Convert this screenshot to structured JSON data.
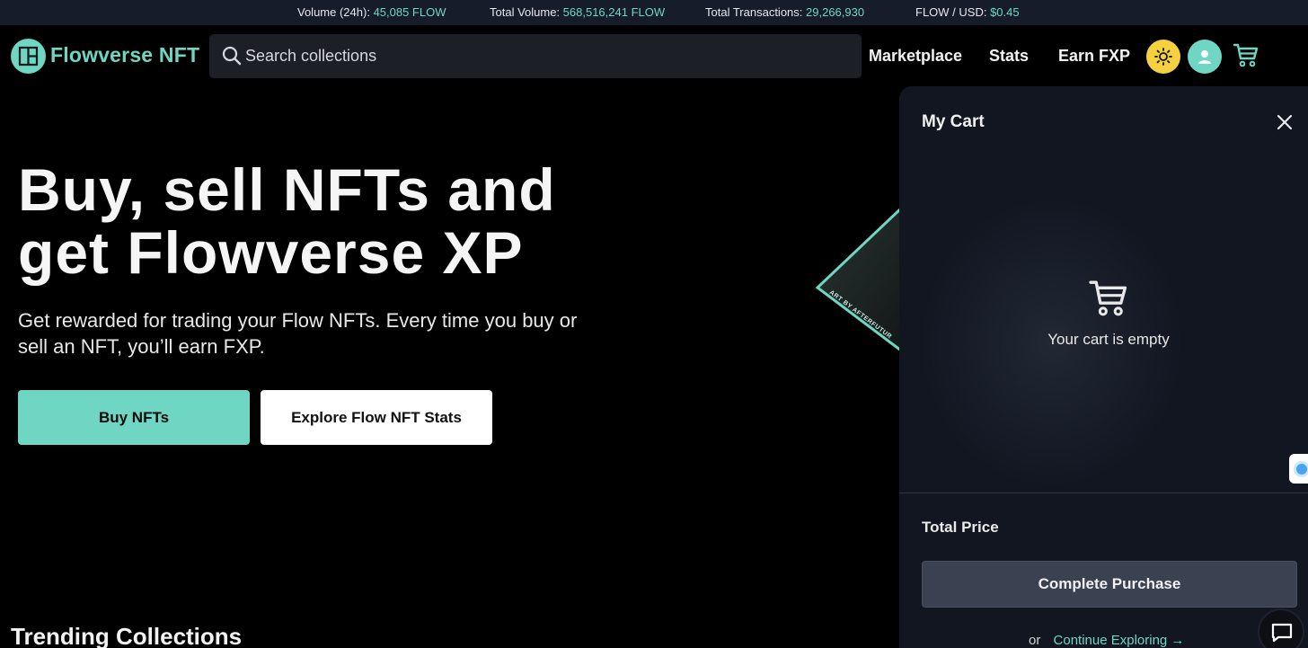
{
  "stats_bar": {
    "volume_24h_label": "Volume (24h):",
    "volume_24h_value": "45,085 FLOW",
    "total_volume_label": "Total Volume:",
    "total_volume_value": "568,516,241 FLOW",
    "total_transactions_label": "Total Transactions:",
    "total_transactions_value": "29,266,930",
    "flow_usd_label": "FLOW / USD:",
    "flow_usd_value": "$0.45"
  },
  "header": {
    "brand": "Flowverse NFT",
    "search_placeholder": "Search collections",
    "nav": [
      "Marketplace",
      "Stats",
      "Earn FXP"
    ]
  },
  "hero": {
    "title_line1": "Buy, sell NFTs and",
    "title_line2": "get Flowverse XP",
    "subtitle": "Get rewarded for trading your Flow NFTs. Every time you buy or sell an NFT, you’ll earn FXP.",
    "primary_button": "Buy NFTs",
    "secondary_button": "Explore Flow NFT Stats"
  },
  "sections": {
    "trending_title": "Trending Collections"
  },
  "art": {
    "caption": "ART BY AFTERFUTUR"
  },
  "cart": {
    "title": "My Cart",
    "empty_text": "Your cart is empty",
    "total_label": "Total Price",
    "purchase_button": "Complete Purchase",
    "or_text": "or",
    "continue_link": "Continue Exploring →"
  },
  "colors": {
    "accent": "#6fd6c3",
    "theme_button": "#f5d142",
    "drawer_bg": "#111621",
    "stats_bar_bg": "#161c2a"
  }
}
